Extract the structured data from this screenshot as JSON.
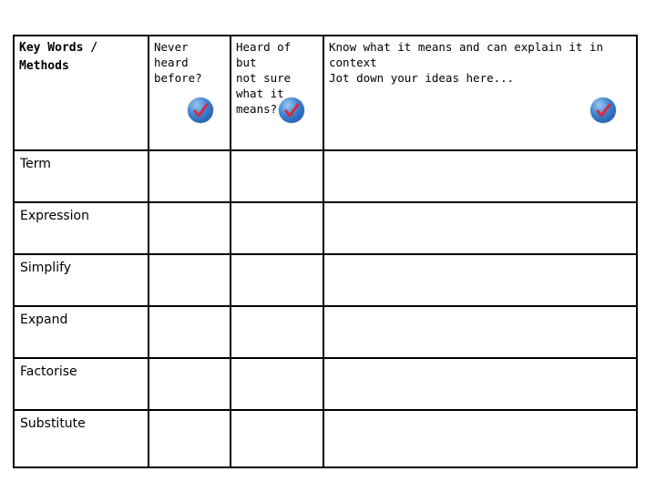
{
  "header": {
    "key_words": "Key Words /\nMethods",
    "never_heard": "Never\nheard\nbefore?",
    "heard_not_sure": "Heard of but\nnot sure\nwhat it\nmeans?",
    "know_explain": "Know what it means and can explain it in\ncontext\nJot down your ideas here...",
    "check_icon": "check-mark-icon",
    "check_colors": {
      "circle": "#3b7fd0",
      "tick": "#d62a3a"
    }
  },
  "terms": [
    {
      "label": "Term"
    },
    {
      "label": "Expression"
    },
    {
      "label": "Simplify"
    },
    {
      "label": "Expand"
    },
    {
      "label": "Factorise"
    },
    {
      "label": "Substitute"
    }
  ]
}
